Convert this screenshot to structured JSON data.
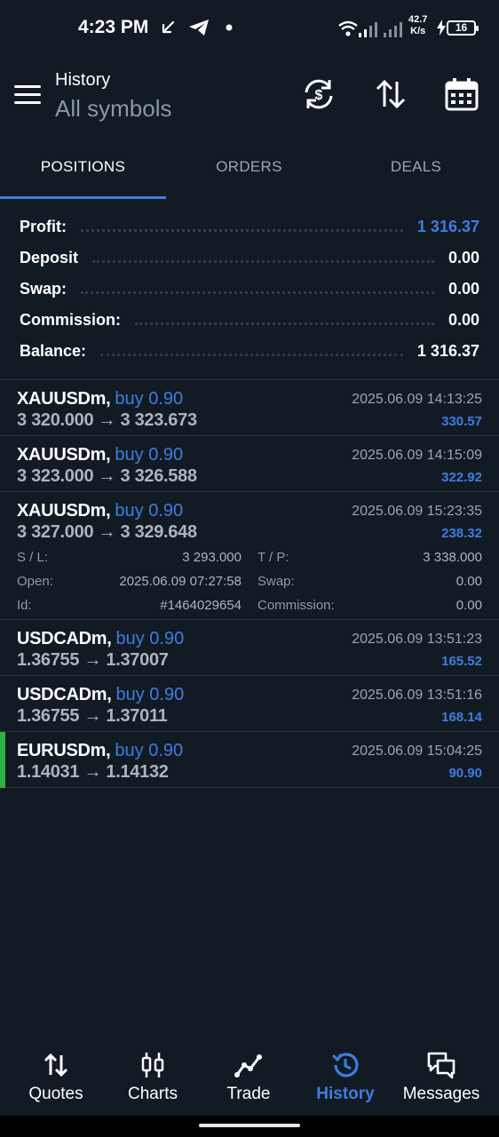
{
  "status_bar": {
    "time": "4:23 PM",
    "speed_value": "42.7",
    "speed_unit": "K/s",
    "battery": "16"
  },
  "header": {
    "title": "History",
    "subtitle": "All symbols",
    "icons": [
      "menu-icon",
      "currency-exchange-icon",
      "sort-icon",
      "calendar-icon"
    ]
  },
  "tabs": [
    {
      "label": "POSITIONS",
      "active": true
    },
    {
      "label": "ORDERS",
      "active": false
    },
    {
      "label": "DEALS",
      "active": false
    }
  ],
  "summary": {
    "profit_label": "Profit:",
    "profit_value": "1 316.37",
    "deposit_label": "Deposit",
    "deposit_value": "0.00",
    "swap_label": "Swap:",
    "swap_value": "0.00",
    "commission_label": "Commission:",
    "commission_value": "0.00",
    "balance_label": "Balance:",
    "balance_value": "1 316.37"
  },
  "positions": [
    {
      "symbol": "XAUUSDm,",
      "side": "buy 0.90",
      "prices": "3 320.000 → 3 323.673",
      "date": "2025.06.09 14:13:25",
      "profit": "330.57"
    },
    {
      "symbol": "XAUUSDm,",
      "side": "buy 0.90",
      "prices": "3 323.000 → 3 326.588",
      "date": "2025.06.09 14:15:09",
      "profit": "322.92"
    },
    {
      "symbol": "XAUUSDm,",
      "side": "buy 0.90",
      "prices": "3 327.000 → 3 329.648",
      "date": "2025.06.09 15:23:35",
      "profit": "238.32",
      "details": {
        "sl_label": "S / L:",
        "sl_value": "3 293.000",
        "tp_label": "T / P:",
        "tp_value": "3 338.000",
        "open_label": "Open:",
        "open_value": "2025.06.09 07:27:58",
        "swap_label": "Swap:",
        "swap_value": "0.00",
        "id_label": "Id:",
        "id_value": "#1464029654",
        "commission_label": "Commission:",
        "commission_value": "0.00"
      }
    },
    {
      "symbol": "USDCADm,",
      "side": "buy 0.90",
      "prices": "1.36755 → 1.37007",
      "date": "2025.06.09 13:51:23",
      "profit": "165.52"
    },
    {
      "symbol": "USDCADm,",
      "side": "buy 0.90",
      "prices": "1.36755 → 1.37011",
      "date": "2025.06.09 13:51:16",
      "profit": "168.14"
    },
    {
      "symbol": "EURUSDm,",
      "side": "buy 0.90",
      "prices": "1.14031 → 1.14132",
      "date": "2025.06.09 15:04:25",
      "profit": "90.90"
    }
  ],
  "bottom_nav": [
    {
      "label": "Quotes",
      "icon": "quotes-arrows-icon"
    },
    {
      "label": "Charts",
      "icon": "candlestick-icon"
    },
    {
      "label": "Trade",
      "icon": "trend-line-icon"
    },
    {
      "label": "History",
      "icon": "history-clock-icon",
      "active": true
    },
    {
      "label": "Messages",
      "icon": "chat-bubbles-icon"
    }
  ],
  "colors": {
    "background": "#121a24",
    "accent": "#3d7ee0",
    "muted": "#9aa6b4",
    "active_marker": "#2bb34a"
  }
}
